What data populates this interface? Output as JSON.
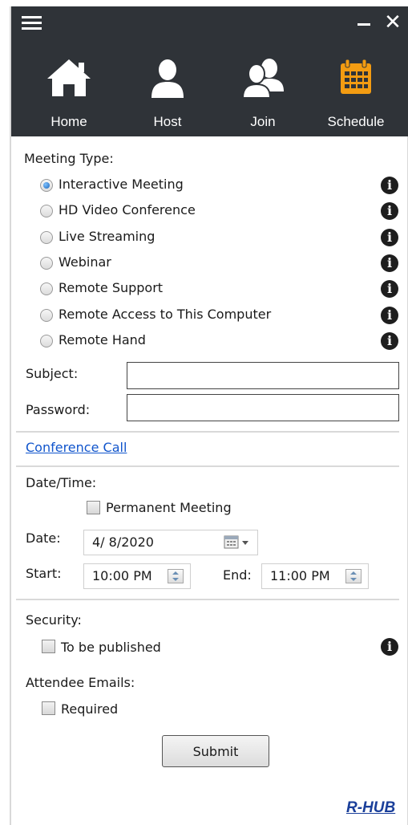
{
  "titlebar": {
    "minimize": "−",
    "close": "✕"
  },
  "nav": {
    "tabs": [
      {
        "label": "Home",
        "icon": "home-icon",
        "active": false
      },
      {
        "label": "Host",
        "icon": "person-icon",
        "active": false
      },
      {
        "label": "Join",
        "icon": "people-icon",
        "active": false
      },
      {
        "label": "Schedule",
        "icon": "calendar-icon",
        "active": true
      }
    ],
    "accent_color": "#f39c12",
    "background": "#2f3338"
  },
  "meeting_type": {
    "heading": "Meeting Type:",
    "selected": "Interactive Meeting",
    "options": [
      {
        "label": "Interactive Meeting",
        "checked": true
      },
      {
        "label": "HD Video Conference",
        "checked": false
      },
      {
        "label": "Live Streaming",
        "checked": false
      },
      {
        "label": "Webinar",
        "checked": false
      },
      {
        "label": "Remote Support",
        "checked": false
      },
      {
        "label": "Remote Access to This Computer",
        "checked": false
      },
      {
        "label": "Remote Hand",
        "checked": false
      }
    ]
  },
  "subject": {
    "label": "Subject:",
    "value": ""
  },
  "password": {
    "label": "Password:",
    "value": ""
  },
  "conference_call": {
    "label": "Conference Call"
  },
  "datetime": {
    "heading": "Date/Time:",
    "permanent": {
      "label": "Permanent Meeting",
      "checked": false
    },
    "date": {
      "label": "Date:",
      "value": "4/ 8/2020"
    },
    "start": {
      "label": "Start:",
      "value": "10:00 PM"
    },
    "end": {
      "label": "End:",
      "value": "11:00 PM"
    }
  },
  "security": {
    "heading": "Security:",
    "publish": {
      "label": "To be published",
      "checked": false
    }
  },
  "attendee": {
    "heading": "Attendee Emails:",
    "required": {
      "label": "Required",
      "checked": false
    }
  },
  "submit_label": "Submit",
  "brand": "R-HUB"
}
